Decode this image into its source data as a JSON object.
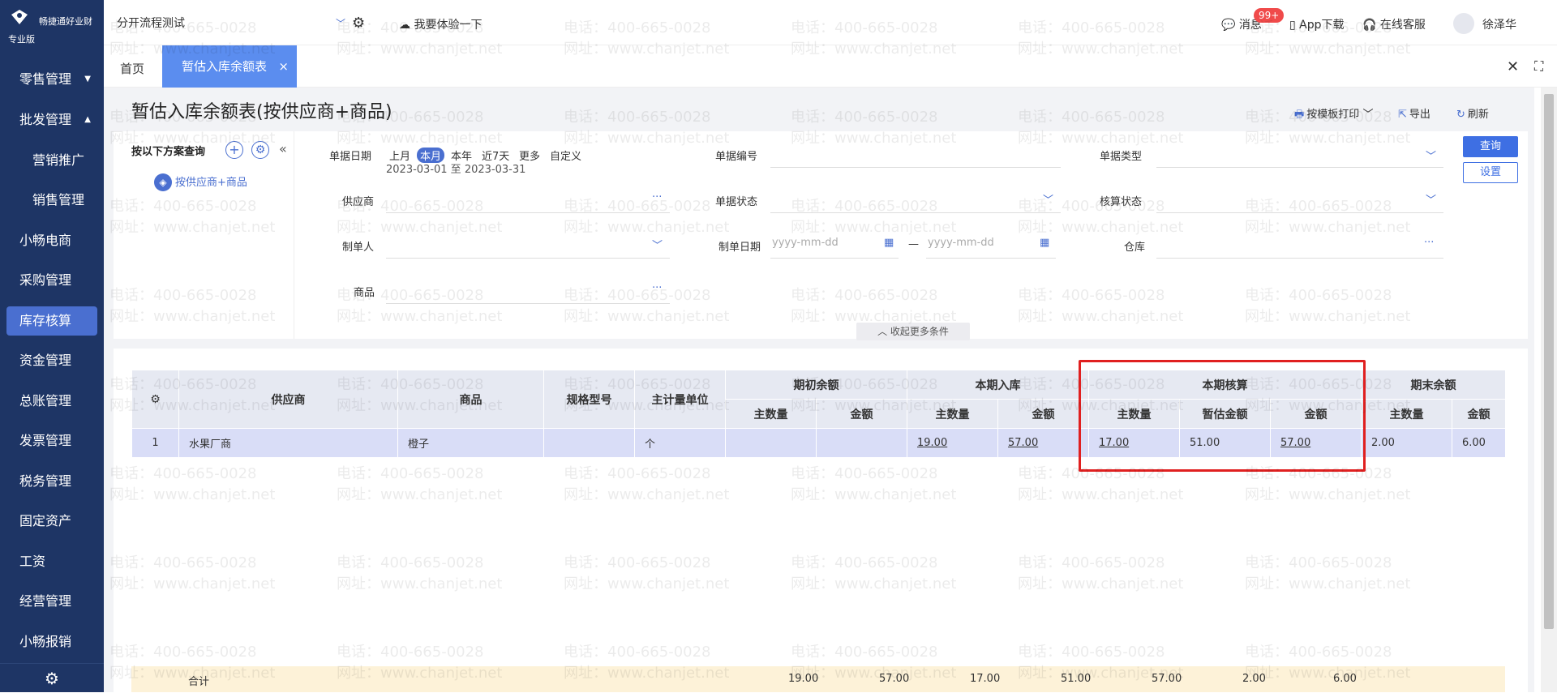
{
  "brand": {
    "name": "畅捷通好业财",
    "edition": "专业版"
  },
  "sidebar": {
    "items": [
      {
        "label": "零售管理",
        "arrow": "▼"
      },
      {
        "label": "批发管理",
        "arrow": "▲"
      },
      {
        "label": "营销推广"
      },
      {
        "label": "销售管理"
      },
      {
        "label": "小畅电商"
      },
      {
        "label": "采购管理"
      },
      {
        "label": "库存核算"
      },
      {
        "label": "资金管理"
      },
      {
        "label": "总账管理"
      },
      {
        "label": "发票管理"
      },
      {
        "label": "税务管理"
      },
      {
        "label": "固定资产"
      },
      {
        "label": "工资"
      },
      {
        "label": "经营管理"
      },
      {
        "label": "小畅报销"
      }
    ]
  },
  "topbar": {
    "flow": "分开流程测试",
    "try": "我要体验一下",
    "messages": "消息",
    "badge": "99+",
    "app": "App下载",
    "service": "在线客服",
    "user": "徐泽华"
  },
  "tabs": {
    "home": "首页",
    "active": "暂估入库余额表",
    "close": "×"
  },
  "page": {
    "title": "暂估入库余额表(按供应商+商品)",
    "print": "按模板打印",
    "export": "导出",
    "refresh": "刷新"
  },
  "scheme": {
    "title": "按以下方案查询",
    "item": "按供应商+商品"
  },
  "filters": {
    "doc_date": "单据日期",
    "opts": [
      "上月",
      "本月",
      "本年",
      "近7天",
      "更多",
      "自定义"
    ],
    "range": "2023-03-01 至 2023-03-31",
    "doc_no": "单据编号",
    "doc_type": "单据类型",
    "supplier": "供应商",
    "doc_status": "单据状态",
    "calc_status": "核算状态",
    "maker": "制单人",
    "make_date": "制单日期",
    "date_ph": "yyyy-mm-dd",
    "dash": "—",
    "warehouse": "仓库",
    "goods": "商品",
    "query": "查询",
    "settings": "设置",
    "collapse": "收起更多条件"
  },
  "table": {
    "headers": {
      "supplier": "供应商",
      "goods": "商品",
      "spec": "规格型号",
      "unit": "主计量单位",
      "opening": "期初余额",
      "inbound": "本期入库",
      "calc": "本期核算",
      "closing": "期末余额",
      "qty": "主数量",
      "amount": "金额",
      "est_amount": "暂估金额"
    },
    "row": {
      "no": "1",
      "supplier": "水果厂商",
      "goods": "橙子",
      "unit": "个",
      "in_qty": "19.00",
      "in_amt": "57.00",
      "calc_qty": "17.00",
      "calc_est": "51.00",
      "calc_amt": "57.00",
      "close_qty": "2.00",
      "close_amt": "6.00"
    },
    "total": {
      "label": "合计",
      "in_qty": "19.00",
      "in_amt": "57.00",
      "calc_qty": "17.00",
      "calc_est": "51.00",
      "calc_amt": "57.00",
      "close_qty": "2.00",
      "close_amt": "6.00"
    }
  },
  "watermark": {
    "phone": "电话：400-665-0028",
    "site": "网址：www.chanjet.net"
  }
}
